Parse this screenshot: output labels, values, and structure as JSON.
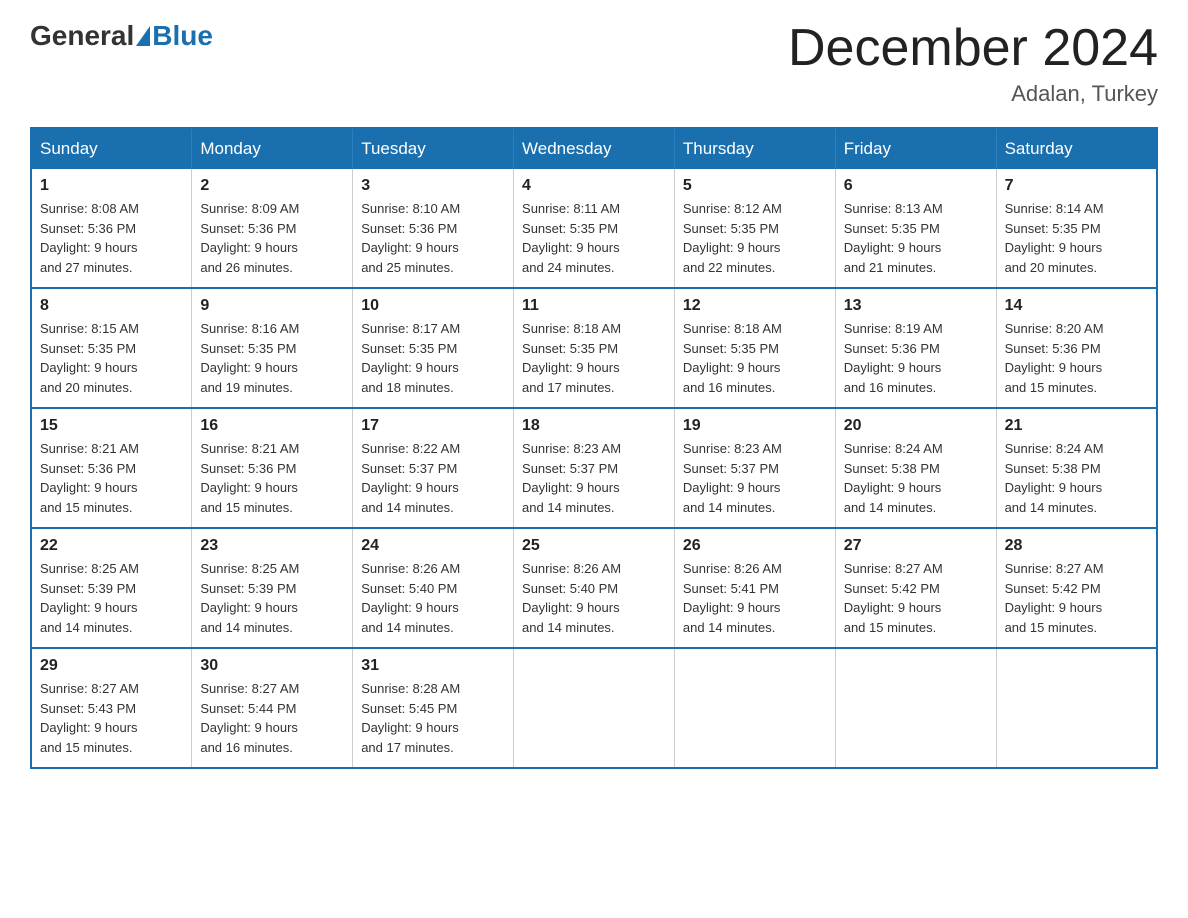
{
  "logo": {
    "text_general": "General",
    "text_blue": "Blue"
  },
  "header": {
    "month_title": "December 2024",
    "location": "Adalan, Turkey"
  },
  "weekdays": [
    "Sunday",
    "Monday",
    "Tuesday",
    "Wednesday",
    "Thursday",
    "Friday",
    "Saturday"
  ],
  "weeks": [
    [
      {
        "day": "1",
        "sunrise": "8:08 AM",
        "sunset": "5:36 PM",
        "daylight": "9 hours and 27 minutes."
      },
      {
        "day": "2",
        "sunrise": "8:09 AM",
        "sunset": "5:36 PM",
        "daylight": "9 hours and 26 minutes."
      },
      {
        "day": "3",
        "sunrise": "8:10 AM",
        "sunset": "5:36 PM",
        "daylight": "9 hours and 25 minutes."
      },
      {
        "day": "4",
        "sunrise": "8:11 AM",
        "sunset": "5:35 PM",
        "daylight": "9 hours and 24 minutes."
      },
      {
        "day": "5",
        "sunrise": "8:12 AM",
        "sunset": "5:35 PM",
        "daylight": "9 hours and 22 minutes."
      },
      {
        "day": "6",
        "sunrise": "8:13 AM",
        "sunset": "5:35 PM",
        "daylight": "9 hours and 21 minutes."
      },
      {
        "day": "7",
        "sunrise": "8:14 AM",
        "sunset": "5:35 PM",
        "daylight": "9 hours and 20 minutes."
      }
    ],
    [
      {
        "day": "8",
        "sunrise": "8:15 AM",
        "sunset": "5:35 PM",
        "daylight": "9 hours and 20 minutes."
      },
      {
        "day": "9",
        "sunrise": "8:16 AM",
        "sunset": "5:35 PM",
        "daylight": "9 hours and 19 minutes."
      },
      {
        "day": "10",
        "sunrise": "8:17 AM",
        "sunset": "5:35 PM",
        "daylight": "9 hours and 18 minutes."
      },
      {
        "day": "11",
        "sunrise": "8:18 AM",
        "sunset": "5:35 PM",
        "daylight": "9 hours and 17 minutes."
      },
      {
        "day": "12",
        "sunrise": "8:18 AM",
        "sunset": "5:35 PM",
        "daylight": "9 hours and 16 minutes."
      },
      {
        "day": "13",
        "sunrise": "8:19 AM",
        "sunset": "5:36 PM",
        "daylight": "9 hours and 16 minutes."
      },
      {
        "day": "14",
        "sunrise": "8:20 AM",
        "sunset": "5:36 PM",
        "daylight": "9 hours and 15 minutes."
      }
    ],
    [
      {
        "day": "15",
        "sunrise": "8:21 AM",
        "sunset": "5:36 PM",
        "daylight": "9 hours and 15 minutes."
      },
      {
        "day": "16",
        "sunrise": "8:21 AM",
        "sunset": "5:36 PM",
        "daylight": "9 hours and 15 minutes."
      },
      {
        "day": "17",
        "sunrise": "8:22 AM",
        "sunset": "5:37 PM",
        "daylight": "9 hours and 14 minutes."
      },
      {
        "day": "18",
        "sunrise": "8:23 AM",
        "sunset": "5:37 PM",
        "daylight": "9 hours and 14 minutes."
      },
      {
        "day": "19",
        "sunrise": "8:23 AM",
        "sunset": "5:37 PM",
        "daylight": "9 hours and 14 minutes."
      },
      {
        "day": "20",
        "sunrise": "8:24 AM",
        "sunset": "5:38 PM",
        "daylight": "9 hours and 14 minutes."
      },
      {
        "day": "21",
        "sunrise": "8:24 AM",
        "sunset": "5:38 PM",
        "daylight": "9 hours and 14 minutes."
      }
    ],
    [
      {
        "day": "22",
        "sunrise": "8:25 AM",
        "sunset": "5:39 PM",
        "daylight": "9 hours and 14 minutes."
      },
      {
        "day": "23",
        "sunrise": "8:25 AM",
        "sunset": "5:39 PM",
        "daylight": "9 hours and 14 minutes."
      },
      {
        "day": "24",
        "sunrise": "8:26 AM",
        "sunset": "5:40 PM",
        "daylight": "9 hours and 14 minutes."
      },
      {
        "day": "25",
        "sunrise": "8:26 AM",
        "sunset": "5:40 PM",
        "daylight": "9 hours and 14 minutes."
      },
      {
        "day": "26",
        "sunrise": "8:26 AM",
        "sunset": "5:41 PM",
        "daylight": "9 hours and 14 minutes."
      },
      {
        "day": "27",
        "sunrise": "8:27 AM",
        "sunset": "5:42 PM",
        "daylight": "9 hours and 15 minutes."
      },
      {
        "day": "28",
        "sunrise": "8:27 AM",
        "sunset": "5:42 PM",
        "daylight": "9 hours and 15 minutes."
      }
    ],
    [
      {
        "day": "29",
        "sunrise": "8:27 AM",
        "sunset": "5:43 PM",
        "daylight": "9 hours and 15 minutes."
      },
      {
        "day": "30",
        "sunrise": "8:27 AM",
        "sunset": "5:44 PM",
        "daylight": "9 hours and 16 minutes."
      },
      {
        "day": "31",
        "sunrise": "8:28 AM",
        "sunset": "5:45 PM",
        "daylight": "9 hours and 17 minutes."
      },
      null,
      null,
      null,
      null
    ]
  ],
  "labels": {
    "sunrise": "Sunrise:",
    "sunset": "Sunset:",
    "daylight": "Daylight:"
  }
}
